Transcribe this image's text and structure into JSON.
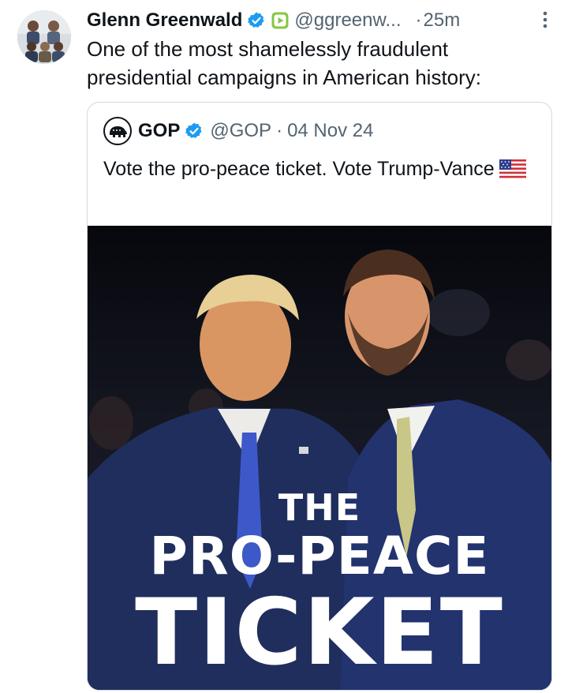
{
  "tweet": {
    "author_name": "Glenn Greenwald",
    "handle": "@ggreenw...",
    "separator": "·",
    "time": "25m",
    "text": "One of the most shamelessly fraudulent presidential campaigns in American history:",
    "avatar_icon": "group-photo-avatar",
    "verified_icon": "verified-badge-icon",
    "subscription_icon": "rumble-play-icon",
    "more_icon": "more-vertical-icon"
  },
  "quote": {
    "author_name": "GOP",
    "handle": "@GOP",
    "separator": "·",
    "date": "04 Nov 24",
    "text": "Vote the pro-peace ticket. Vote Trump-Vance",
    "flag_icon": "us-flag-emoji",
    "avatar_icon": "gop-elephant-logo",
    "media": {
      "overlay_line1": "THE",
      "overlay_line2": "PRO-PEACE",
      "overlay_line3": "TICKET",
      "gradient_colors": [
        "#c92a2f",
        "#6c2b5e",
        "#1f3c8f"
      ]
    }
  },
  "colors": {
    "verified_blue": "#1d9bf0",
    "rumble_green": "#85c742",
    "secondary_text": "#536471",
    "border": "#cfd9de"
  }
}
